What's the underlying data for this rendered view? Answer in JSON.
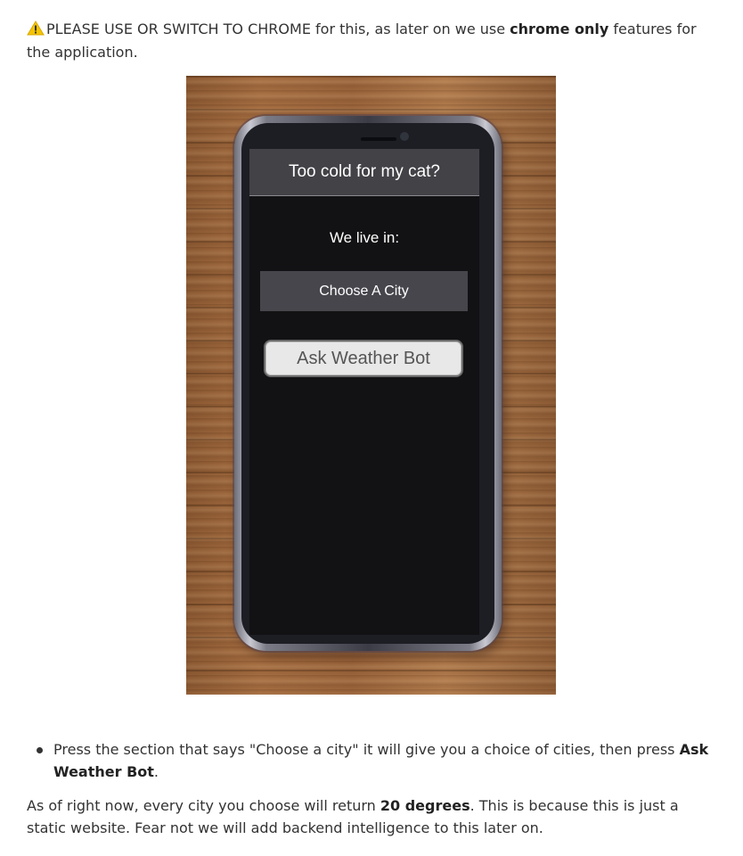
{
  "warning": {
    "text_before": "PLEASE USE OR SWITCH TO CHROME for this, as later on we use ",
    "emphasis": "chrome only",
    "text_after": " features for the application."
  },
  "colors": {
    "warning_icon": "#f5c400",
    "app_header_bg": "#434247",
    "app_screen_bg": "#121214",
    "select_bg": "#47464c",
    "button_bg": "#e8e8e8"
  },
  "phone_app": {
    "header_title": "Too cold for my cat?",
    "location_label": "We live in:",
    "city_select_value": "Choose A City",
    "ask_button_label": "Ask Weather Bot"
  },
  "instructions": {
    "bullet_text": "Press the section that says \"Choose a city\" it will give you a choice of cities, then press ",
    "bullet_emphasis": "Ask Weather Bot",
    "bullet_end": "."
  },
  "note": {
    "text_before": "As of right now, every city you choose will return ",
    "emphasis": "20 degrees",
    "text_after": ". This is because this is just a static website. Fear not we will add backend intelligence to this later on."
  }
}
